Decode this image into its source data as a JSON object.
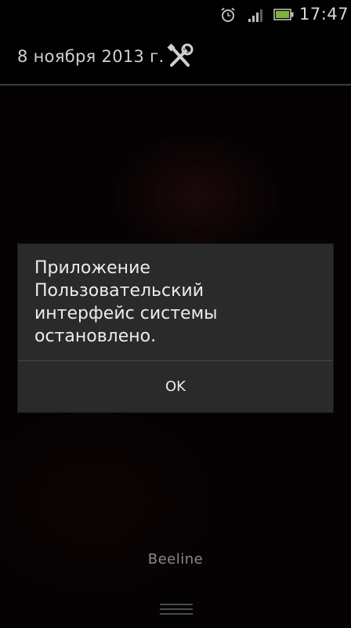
{
  "status_bar": {
    "time": "17:47",
    "icons": [
      "alarm-icon",
      "signal-icon",
      "battery-icon"
    ]
  },
  "notification_header": {
    "date": "8 ноября 2013 г.",
    "settings_icon": "settings-icon"
  },
  "dialog": {
    "message_lines": [
      "Приложение",
      "Пользовательский",
      "интерфейс системы",
      "остановлено."
    ],
    "ok_label": "OK"
  },
  "carrier": "Beeline",
  "colors": {
    "background": "#050203",
    "dialog_background": "#2a2a2a",
    "text": "#ececec",
    "divider": "#3a3a3a"
  }
}
